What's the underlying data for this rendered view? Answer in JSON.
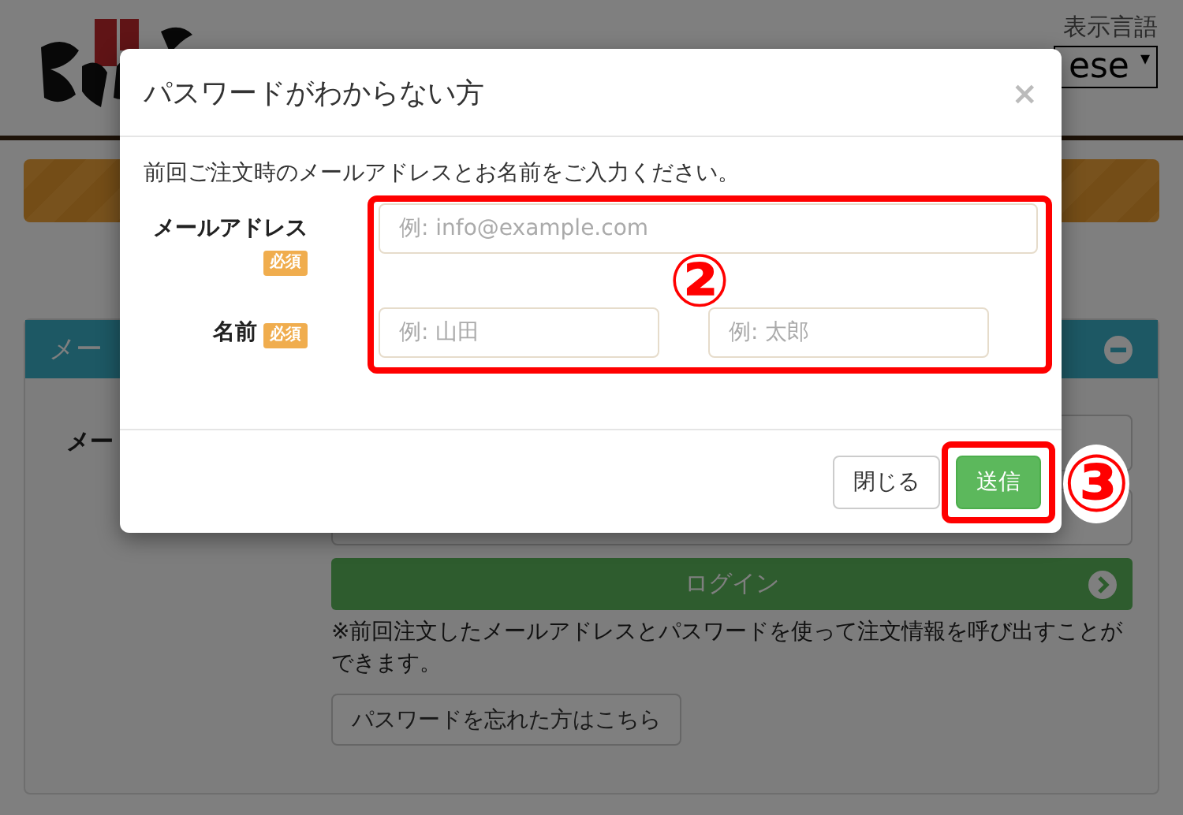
{
  "header": {
    "language_label": "表示言語",
    "language_select": "ese",
    "select_caret": "▾"
  },
  "panel": {
    "title": "メー",
    "field_label": "メー",
    "login_button": "ログイン",
    "note": "※前回注文したメールアドレスとパスワードを使って注文情報を呼び出すことができます。",
    "forgot_button": "パスワードを忘れた方はこちら"
  },
  "modal": {
    "title": "パスワードがわからない方",
    "close": "×",
    "intro": "前回ご注文時のメールアドレスとお名前をご入力ください。",
    "fields": [
      {
        "label": "メールアドレス",
        "required": "必須",
        "inputs": [
          {
            "placeholder": "例: info@example.com"
          }
        ]
      },
      {
        "label": "名前",
        "required": "必須",
        "inputs": [
          {
            "placeholder": "例: 山田"
          },
          {
            "placeholder": "例: 太郎"
          }
        ]
      }
    ],
    "buttons": [
      {
        "label": "閉じる",
        "kind": "default"
      },
      {
        "label": "送信",
        "kind": "primary"
      }
    ]
  },
  "annotations": [
    {
      "label": "②"
    },
    {
      "label": "③"
    }
  ]
}
